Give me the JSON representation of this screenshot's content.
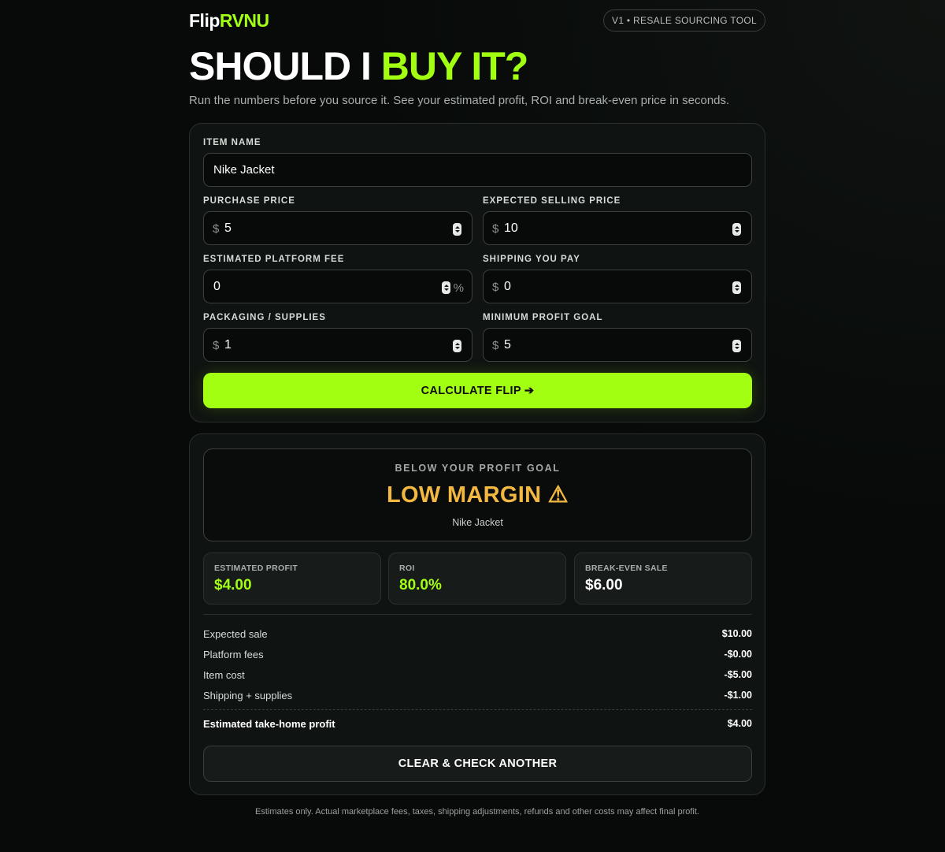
{
  "header": {
    "logo_main": "Flip",
    "logo_accent": "RVNU",
    "version_badge": "V1 • RESALE SOURCING TOOL"
  },
  "hero": {
    "title_main": "SHOULD I ",
    "title_accent": "BUY IT?",
    "subtitle": "Run the numbers before you source it. See your estimated profit, ROI and break-even price in seconds."
  },
  "form": {
    "item_name": {
      "label": "ITEM NAME",
      "value": "Nike Jacket"
    },
    "purchase_price": {
      "label": "PURCHASE PRICE",
      "prefix": "$",
      "value": "5"
    },
    "expected_selling_price": {
      "label": "EXPECTED SELLING PRICE",
      "prefix": "$",
      "value": "10"
    },
    "platform_fee": {
      "label": "ESTIMATED PLATFORM FEE",
      "value": "0",
      "suffix": "%"
    },
    "shipping": {
      "label": "SHIPPING YOU PAY",
      "prefix": "$",
      "value": "0"
    },
    "packaging": {
      "label": "PACKAGING / SUPPLIES",
      "prefix": "$",
      "value": "1"
    },
    "min_profit_goal": {
      "label": "MINIMUM PROFIT GOAL",
      "prefix": "$",
      "value": "5"
    },
    "calculate_label": "CALCULATE FLIP ➔"
  },
  "result": {
    "kicker": "BELOW YOUR PROFIT GOAL",
    "status": "LOW MARGIN ⚠",
    "item": "Nike Jacket",
    "stats": [
      {
        "label": "ESTIMATED PROFIT",
        "value": "$4.00",
        "color": "#a3ff12"
      },
      {
        "label": "ROI",
        "value": "80.0%",
        "color": "#a3ff12"
      },
      {
        "label": "BREAK-EVEN SALE",
        "value": "$6.00",
        "color": "#ffffff"
      }
    ],
    "breakdown": [
      {
        "label": "Expected sale",
        "value": "$10.00"
      },
      {
        "label": "Platform fees",
        "value": "-$0.00"
      },
      {
        "label": "Item cost",
        "value": "-$5.00"
      },
      {
        "label": "Shipping + supplies",
        "value": "-$1.00"
      }
    ],
    "total": {
      "label": "Estimated take-home profit",
      "value": "$4.00"
    },
    "clear_label": "CLEAR & CHECK ANOTHER"
  },
  "disclaimer": "Estimates only. Actual marketplace fees, taxes, shipping adjustments, refunds and other costs may affect final profit.",
  "colors": {
    "accent": "#a3ff12",
    "warning": "#f3b842",
    "background": "#070a09"
  }
}
